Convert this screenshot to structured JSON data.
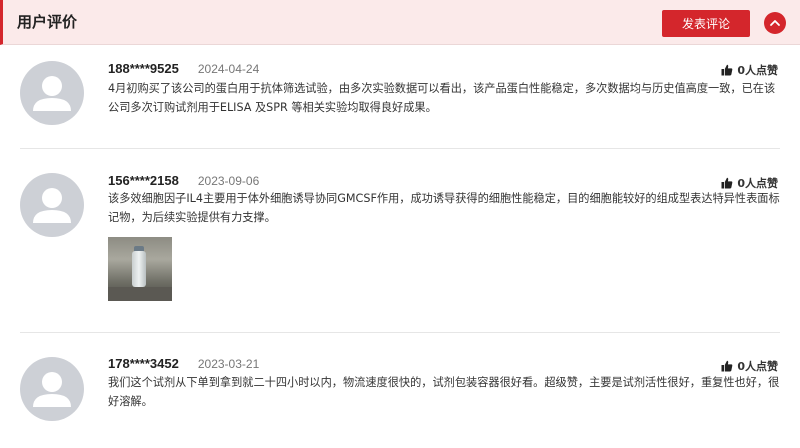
{
  "header": {
    "title": "用户评价",
    "post_button": "发表评论",
    "collapse_icon": "chevron-up-icon",
    "accent_color": "#d4262c"
  },
  "reviews": [
    {
      "user": "188****9525",
      "date": "2024-04-24",
      "likes": "0人点赞",
      "text": "4月初购买了该公司的蛋白用于抗体筛选试验，由多次实验数据可以看出，该产品蛋白性能稳定，多次数据均与历史值高度一致，已在该公司多次订购试剂用于ELISA 及SPR 等相关实验均取得良好成果。"
    },
    {
      "user": "156****2158",
      "date": "2023-09-06",
      "likes": "0人点赞",
      "text": "该多效细胞因子IL4主要用于体外细胞诱导协同GMCSF作用，成功诱导获得的细胞性能稳定，目的细胞能较好的组成型表达特异性表面标记物，为后续实验提供有力支撑。",
      "has_photo": true
    },
    {
      "user": "178****3452",
      "date": "2023-03-21",
      "likes": "0人点赞",
      "text": "我们这个试剂从下单到拿到就二十四小时以内，物流速度很快的，试剂包装容器很好看。超级赞，主要是试剂活性很好，重复性也好，很好溶解。"
    }
  ]
}
